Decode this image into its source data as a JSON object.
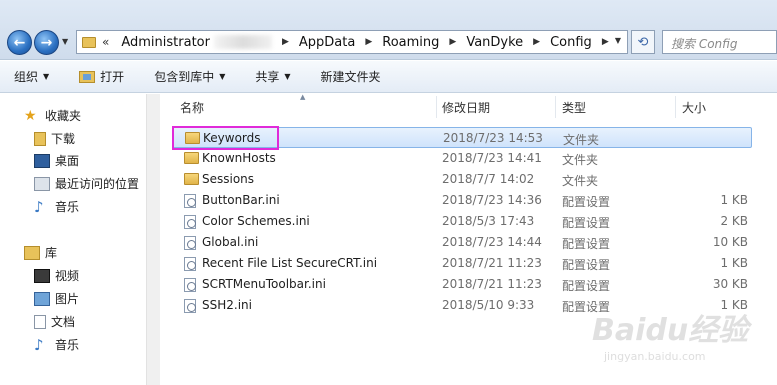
{
  "breadcrumb": {
    "prefix": "«",
    "items": [
      "Administrator",
      "AppData",
      "Roaming",
      "VanDyke",
      "Config"
    ]
  },
  "search": {
    "placeholder": "搜索 Config"
  },
  "toolbar": {
    "organize": "组织",
    "open": "打开",
    "include_in_library": "包含到库中",
    "share": "共享",
    "new_folder": "新建文件夹"
  },
  "sidebar": {
    "favorites_label": "收藏夹",
    "favorites": [
      "下载",
      "桌面",
      "最近访问的位置",
      "音乐"
    ],
    "libraries_label": "库",
    "libraries": [
      "视频",
      "图片",
      "文档",
      "音乐"
    ]
  },
  "columns": {
    "name": "名称",
    "date": "修改日期",
    "type": "类型",
    "size": "大小"
  },
  "files": [
    {
      "name": "Keywords",
      "date": "2018/7/23 14:53",
      "type": "文件夹",
      "size": "",
      "icon": "folder-icon"
    },
    {
      "name": "KnownHosts",
      "date": "2018/7/23 14:41",
      "type": "文件夹",
      "size": "",
      "icon": "folder-icon"
    },
    {
      "name": "Sessions",
      "date": "2018/7/7 14:02",
      "type": "文件夹",
      "size": "",
      "icon": "folder-icon"
    },
    {
      "name": "ButtonBar.ini",
      "date": "2018/7/23 14:36",
      "type": "配置设置",
      "size": "1 KB",
      "icon": "ini-file-icon"
    },
    {
      "name": "Color Schemes.ini",
      "date": "2018/5/3 17:43",
      "type": "配置设置",
      "size": "2 KB",
      "icon": "ini-file-icon"
    },
    {
      "name": "Global.ini",
      "date": "2018/7/23 14:44",
      "type": "配置设置",
      "size": "10 KB",
      "icon": "ini-file-icon"
    },
    {
      "name": "Recent File List SecureCRT.ini",
      "date": "2018/7/21 11:23",
      "type": "配置设置",
      "size": "1 KB",
      "icon": "ini-file-icon"
    },
    {
      "name": "SCRTMenuToolbar.ini",
      "date": "2018/7/21 11:23",
      "type": "配置设置",
      "size": "30 KB",
      "icon": "ini-file-icon"
    },
    {
      "name": "SSH2.ini",
      "date": "2018/5/10 9:33",
      "type": "配置设置",
      "size": "1 KB",
      "icon": "ini-file-icon"
    }
  ],
  "watermark": {
    "brand": "Baidu经验",
    "url": "jingyan.baidu.com"
  },
  "colors": {
    "highlight_box": "#e02ad9",
    "selection": "#cfe3fb",
    "folder": "#e8c25a"
  }
}
